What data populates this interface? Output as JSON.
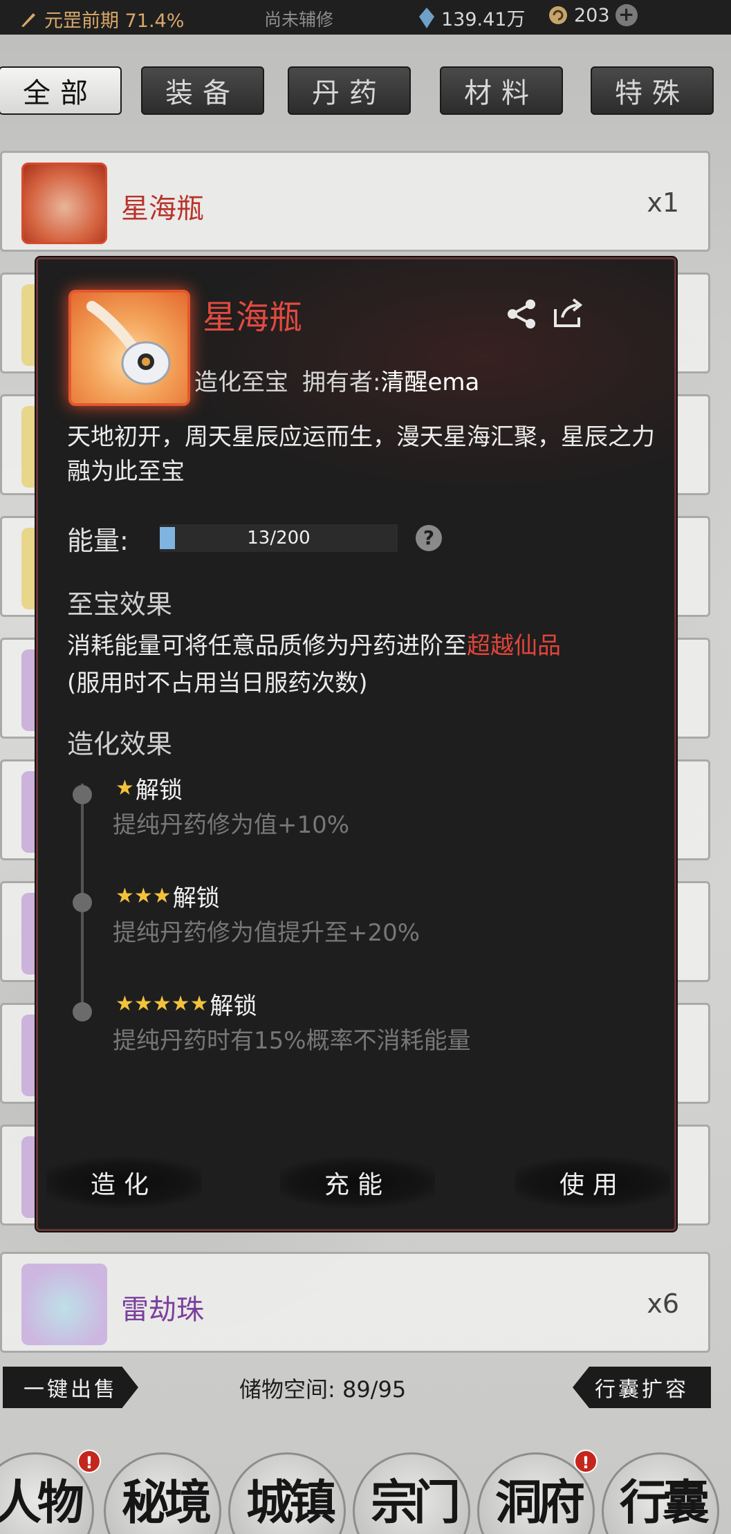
{
  "status": {
    "realm": "元罡前期 71.4%",
    "assist": "尚未辅修",
    "spirit_stones": "139.41万",
    "currency": "203",
    "plus": "+"
  },
  "tabs": [
    {
      "label": "全部",
      "active": true
    },
    {
      "label": "装备",
      "active": false
    },
    {
      "label": "丹药",
      "active": false
    },
    {
      "label": "材料",
      "active": false
    },
    {
      "label": "特殊",
      "active": false
    }
  ],
  "list": {
    "first_item": {
      "name": "星海瓶",
      "count": "x1"
    },
    "last_item": {
      "name": "雷劫珠",
      "count": "x6"
    }
  },
  "modal": {
    "title": "星海瓶",
    "grade": "造化至宝",
    "owner_label": "拥有者:",
    "owner_name": "清醒ema",
    "description": "天地初开，周天星辰应运而生，漫天星海汇聚，星辰之力融为此至宝",
    "energy_label": "能量:",
    "energy_text": "13/200",
    "energy_fraction": 0.065,
    "help": "?",
    "treasure_effect_title": "至宝效果",
    "treasure_effect_prefix": "消耗能量可将任意品质修为丹药进阶至",
    "treasure_effect_highlight": "超越仙品",
    "treasure_effect_note": "(服用时不占用当日服药次数)",
    "creation_effect_title": "造化效果",
    "unlocks": [
      {
        "stars": "★",
        "label": "解锁",
        "desc": "提纯丹药修为值+10%"
      },
      {
        "stars": "★★★",
        "label": "解锁",
        "desc": "提纯丹药修为值提升至+20%"
      },
      {
        "stars": "★★★★★",
        "label": "解锁",
        "desc": "提纯丹药时有15%概率不消耗能量"
      }
    ],
    "buttons": {
      "create": "造化",
      "charge": "充能",
      "use": "使用"
    }
  },
  "bottom": {
    "sell_all": "一键出售",
    "storage": "储物空间: 89/95",
    "expand": "行囊扩容"
  },
  "nav": [
    {
      "label": "人物",
      "badge": "!"
    },
    {
      "label": "秘境",
      "badge": ""
    },
    {
      "label": "城镇",
      "badge": ""
    },
    {
      "label": "宗门",
      "badge": ""
    },
    {
      "label": "洞府",
      "badge": "!"
    },
    {
      "label": "行囊",
      "badge": ""
    }
  ],
  "colors": {
    "highlight_red": "#e0453b",
    "title_red": "#e24a3f",
    "star_gold": "#f3c23d",
    "energy_blue": "#7fb4e0"
  }
}
